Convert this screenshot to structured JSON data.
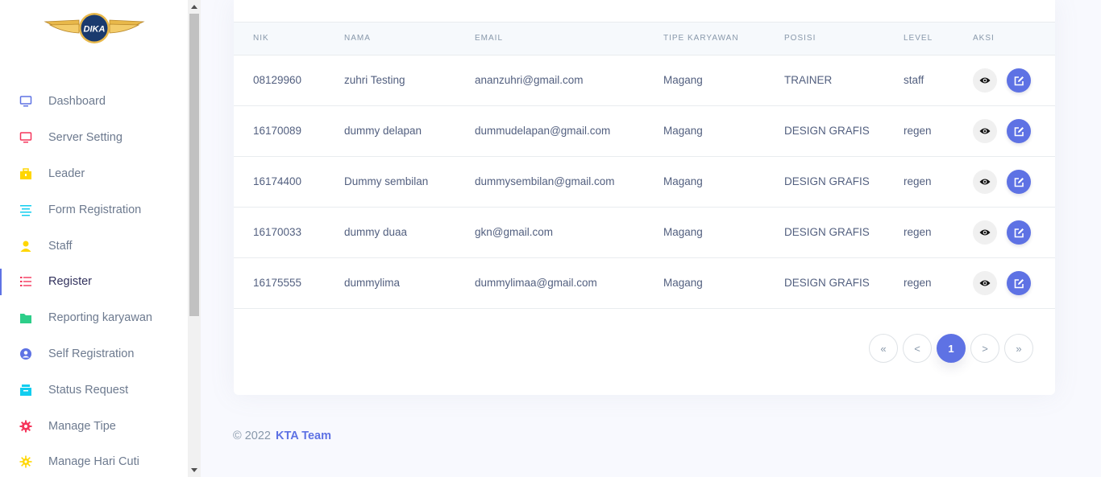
{
  "logo": {
    "text": "DIKA"
  },
  "sidebar": {
    "items": [
      {
        "label": "Dashboard",
        "icon": "monitor-icon",
        "color": "#5e72e4"
      },
      {
        "label": "Server Setting",
        "icon": "monitor-icon",
        "color": "#f5365c"
      },
      {
        "label": "Leader",
        "icon": "briefcase-icon",
        "color": "#ffd600"
      },
      {
        "label": "Form Registration",
        "icon": "align-icon",
        "color": "#11cdef"
      },
      {
        "label": "Staff",
        "icon": "user-icon",
        "color": "#ffd600"
      },
      {
        "label": "Register",
        "icon": "list-icon",
        "color": "#f5365c",
        "active": true
      },
      {
        "label": "Reporting karyawan",
        "icon": "folder-icon",
        "color": "#2dce89"
      },
      {
        "label": "Self Registration",
        "icon": "user-circle-icon",
        "color": "#5e72e4"
      },
      {
        "label": "Status Request",
        "icon": "archive-icon",
        "color": "#11cdef"
      },
      {
        "label": "Manage Tipe",
        "icon": "settings-icon",
        "color": "#f5365c"
      },
      {
        "label": "Manage Hari Cuti",
        "icon": "sun-icon",
        "color": "#ffd600"
      }
    ]
  },
  "table": {
    "headers": [
      "NIK",
      "NAMA",
      "EMAIL",
      "TIPE KARYAWAN",
      "POSISI",
      "LEVEL",
      "AKSI"
    ],
    "rows": [
      {
        "nik": "08129960",
        "nama": "zuhri Testing",
        "email": "ananzuhri@gmail.com",
        "tipe": "Magang",
        "posisi": "TRAINER",
        "level": "staff"
      },
      {
        "nik": "16170089",
        "nama": "dummy delapan",
        "email": "dummudelapan@gmail.com",
        "tipe": "Magang",
        "posisi": "DESIGN GRAFIS",
        "level": "regen"
      },
      {
        "nik": "16174400",
        "nama": "Dummy sembilan",
        "email": "dummysembilan@gmail.com",
        "tipe": "Magang",
        "posisi": "DESIGN GRAFIS",
        "level": "regen"
      },
      {
        "nik": "16170033",
        "nama": "dummy duaa",
        "email": "gkn@gmail.com",
        "tipe": "Magang",
        "posisi": "DESIGN GRAFIS",
        "level": "regen"
      },
      {
        "nik": "16175555",
        "nama": "dummylima",
        "email": "dummylimaa@gmail.com",
        "tipe": "Magang",
        "posisi": "DESIGN GRAFIS",
        "level": "regen"
      }
    ]
  },
  "pagination": {
    "first": "«",
    "prev": "<",
    "current": "1",
    "next": ">",
    "last": "»"
  },
  "footer": {
    "copyright": "© 2022",
    "link": "KTA Team"
  },
  "colors": {
    "primary": "#5e72e4",
    "background": "#f8f9fe"
  }
}
